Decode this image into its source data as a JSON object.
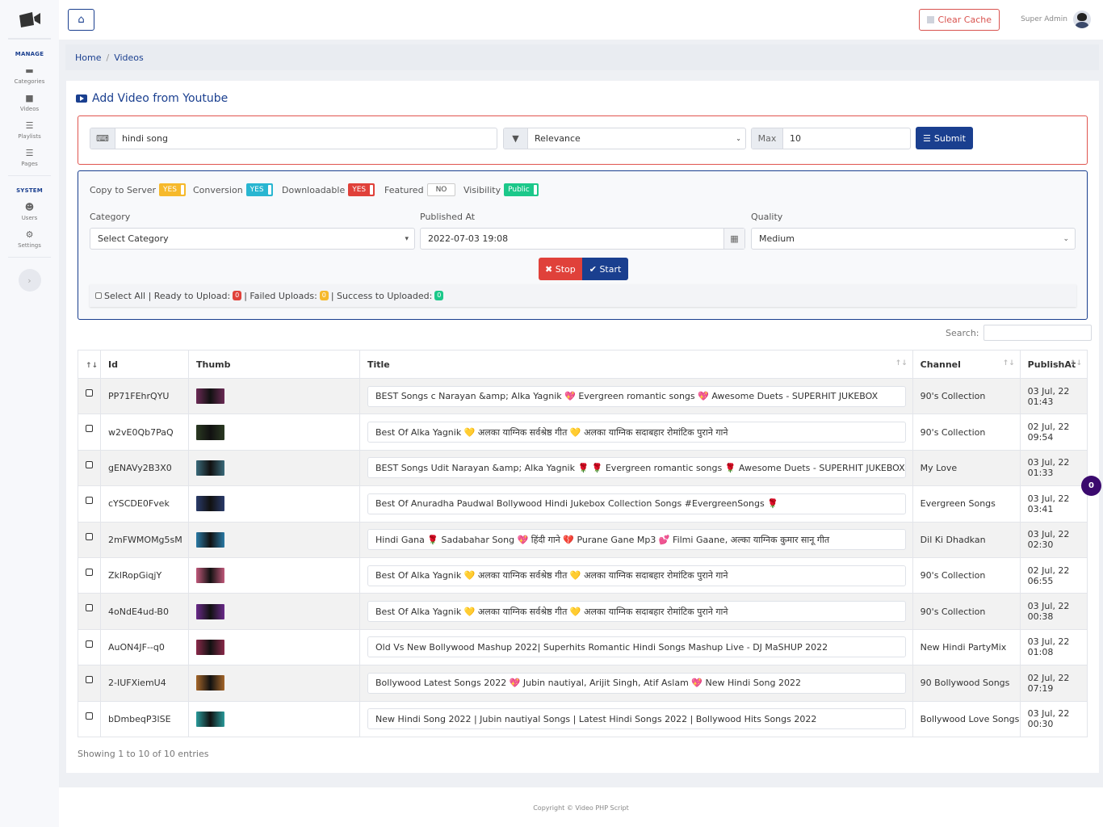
{
  "sidebar": {
    "sections": [
      {
        "title": "MANAGE",
        "items": [
          {
            "label": "Categories",
            "icon": "folder-icon"
          },
          {
            "label": "Videos",
            "icon": "video-icon"
          },
          {
            "label": "Playlists",
            "icon": "list-icon"
          },
          {
            "label": "Pages",
            "icon": "list-icon"
          }
        ]
      },
      {
        "title": "SYSTEM",
        "items": [
          {
            "label": "Users",
            "icon": "users-icon"
          },
          {
            "label": "Settings",
            "icon": "cogs-icon"
          }
        ]
      }
    ]
  },
  "header": {
    "clear_cache": "Clear Cache",
    "user": "Super Admin"
  },
  "breadcrumb": {
    "home": "Home",
    "current": "Videos"
  },
  "card": {
    "title": "Add Video from Youtube"
  },
  "search": {
    "query": "hindi song",
    "order": "Relevance",
    "max_label": "Max",
    "max": "10",
    "submit": "Submit"
  },
  "options": {
    "copy": {
      "label": "Copy to Server",
      "value": "YES",
      "color": "#f6b92b"
    },
    "conversion": {
      "label": "Conversion",
      "value": "YES",
      "color": "#29b6d1"
    },
    "downloadable": {
      "label": "Downloadable",
      "value": "YES",
      "color": "#e0413a"
    },
    "featured": {
      "label": "Featured",
      "value": "NO"
    },
    "visibility": {
      "label": "Visibility",
      "value": "Public",
      "color": "#1cc88a"
    },
    "category_label": "Category",
    "category": "Select Category",
    "published_label": "Published At",
    "published": "2022-07-03 19:08",
    "quality_label": "Quality",
    "quality": "Medium",
    "stop": "Stop",
    "start": "Start",
    "status": {
      "select_all": "Select All | Ready to Upload:",
      "ready": "0",
      "failed_label": "| Failed Uploads:",
      "failed": "0",
      "success_label": "| Success to Uploaded:",
      "success": "0"
    }
  },
  "table": {
    "search_label": "Search:",
    "columns": [
      "Id",
      "Thumb",
      "Title",
      "Channel",
      "PublishAt"
    ],
    "rows": [
      {
        "id": "PP71FEhrQYU",
        "title": "BEST Songs c Narayan &amp; Alka Yagnik 💖 Evergreen romantic songs 💖 Awesome Duets - SUPERHIT JUKEBOX",
        "channel": "90's Collection",
        "date": "03 Jul, 22 01:43",
        "thumb": "#6b2a55"
      },
      {
        "id": "w2vE0Qb7PaQ",
        "title": "Best Of Alka Yagnik 💛 अलका याग्निक सर्वश्रेष्ठ गीत 💛 अलका याग्निक सदाबहार रोमांटिक पुराने गाने",
        "channel": "90's Collection",
        "date": "02 Jul, 22 09:54",
        "thumb": "#2b3a22"
      },
      {
        "id": "gENAVy2B3X0",
        "title": "BEST Songs Udit Narayan &amp; Alka Yagnik 🌹 🌹 Evergreen romantic songs 🌹 Awesome Duets - SUPERHIT JUKEBOX",
        "channel": "My Love",
        "date": "03 Jul, 22 01:33",
        "thumb": "#3a6a7a"
      },
      {
        "id": "cYSCDE0Fvek",
        "title": "Best Of Anuradha Paudwal Bollywood Hindi Jukebox Collection Songs #EvergreenSongs 🌹",
        "channel": "Evergreen Songs",
        "date": "03 Jul, 22 03:41",
        "thumb": "#2a3b6a"
      },
      {
        "id": "2mFWMOMg5sM",
        "title": "Hindi Gana 🌹 Sadabahar Song 💖 हिंदी गाने 💔 Purane Gane Mp3 💕 Filmi Gaane, अल्का याग्निक कुमार सानू गीत",
        "channel": "Dil Ki Dhadkan",
        "date": "03 Jul, 22 02:30",
        "thumb": "#2a7aa5"
      },
      {
        "id": "ZklRopGiqjY",
        "title": "Best Of Alka Yagnik 💛 अलका याग्निक सर्वश्रेष्ठ गीत 💛 अलका याग्निक सदाबहार रोमांटिक पुराने गाने",
        "channel": "90's Collection",
        "date": "02 Jul, 22 06:55",
        "thumb": "#c0587a"
      },
      {
        "id": "4oNdE4ud-B0",
        "title": "Best Of Alka Yagnik 💛 अलका याग्निक सर्वश्रेष्ठ गीत 💛 अलका याग्निक सदाबहार रोमांटिक पुराने गाने",
        "channel": "90's Collection",
        "date": "03 Jul, 22 00:38",
        "thumb": "#6a2a8a"
      },
      {
        "id": "AuON4JF--q0",
        "title": "Old Vs New Bollywood Mashup 2022| Superhits Romantic Hindi Songs Mashup Live - DJ MaSHUP 2022",
        "channel": "New Hindi PartyMix",
        "date": "03 Jul, 22 01:08",
        "thumb": "#8a2a4a"
      },
      {
        "id": "2-IUFXiemU4",
        "title": "Bollywood Latest Songs 2022 💖 Jubin nautiyal, Arijit Singh, Atif Aslam 💖 New Hindi Song 2022",
        "channel": "90 Bollywood Songs",
        "date": "02 Jul, 22 07:19",
        "thumb": "#a5662a"
      },
      {
        "id": "bDmbeqP3lSE",
        "title": "New Hindi Song 2022 | Jubin nautiyal Songs | Latest Hindi Songs 2022 | Bollywood Hits Songs 2022",
        "channel": "Bollywood Love Songs",
        "date": "03 Jul, 22 00:30",
        "thumb": "#2a9a9a"
      }
    ],
    "showing": "Showing 1 to 10 of 10 entries"
  },
  "float_badge": "0",
  "footer": "Copyright © Video PHP Script"
}
